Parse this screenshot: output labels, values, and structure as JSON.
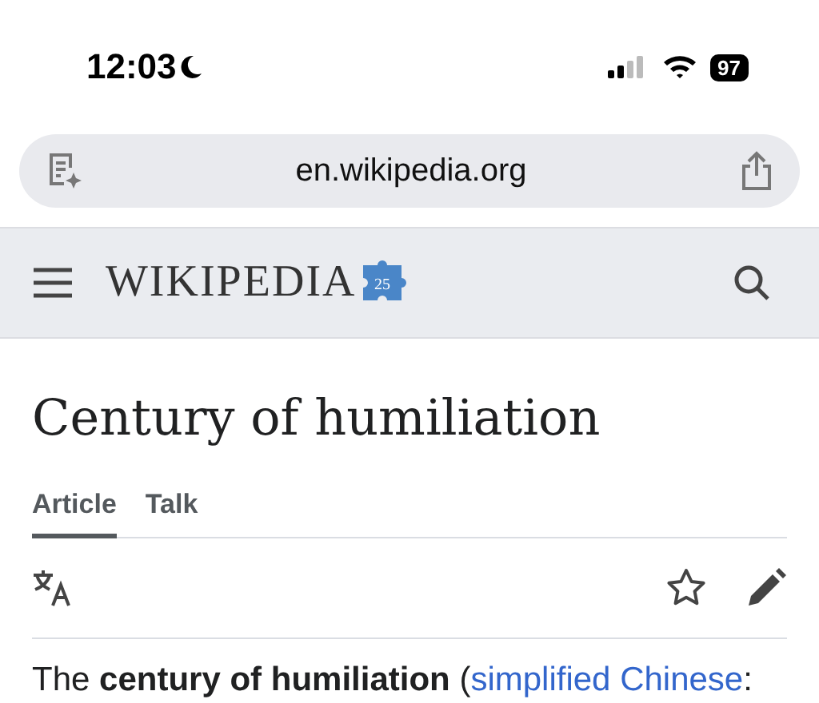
{
  "status_bar": {
    "time": "12:03",
    "battery": "97"
  },
  "address_bar": {
    "url": "en.wikipedia.org"
  },
  "header": {
    "logo": "WIKIPEDIA",
    "logo_badge": "25"
  },
  "article": {
    "title": "Century of humiliation",
    "tabs": [
      {
        "label": "Article",
        "selected": true
      },
      {
        "label": "Talk",
        "selected": false
      }
    ],
    "intro": {
      "before": "The **century of humiliation** (",
      "link": "simplified Chinese",
      "after": ":"
    }
  }
}
